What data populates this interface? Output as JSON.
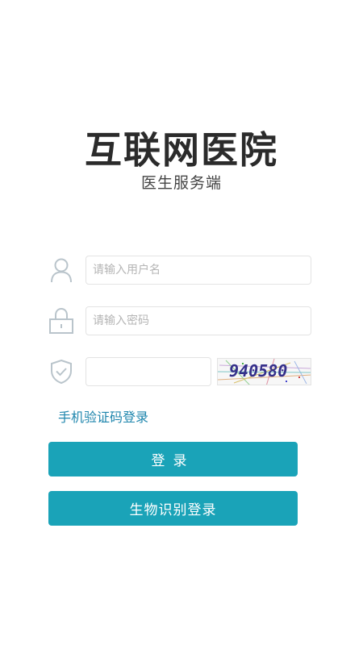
{
  "header": {
    "title": "互联网医院",
    "subtitle": "医生服务端"
  },
  "form": {
    "username": {
      "value": "",
      "placeholder": "请输入用户名",
      "icon": "user-icon"
    },
    "password": {
      "value": "",
      "placeholder": "请输入密码",
      "icon": "lock-icon"
    },
    "captcha": {
      "value": "",
      "placeholder": "",
      "icon": "shield-check-icon",
      "image_text": "940580"
    }
  },
  "links": {
    "sms_login": "手机验证码登录"
  },
  "buttons": {
    "login": "登录",
    "biometric_login": "生物识别登录"
  },
  "colors": {
    "accent": "#1aa3b8",
    "link": "#1f86ad",
    "icon": "#b9c4cb",
    "input_border": "#e3e3e3"
  }
}
